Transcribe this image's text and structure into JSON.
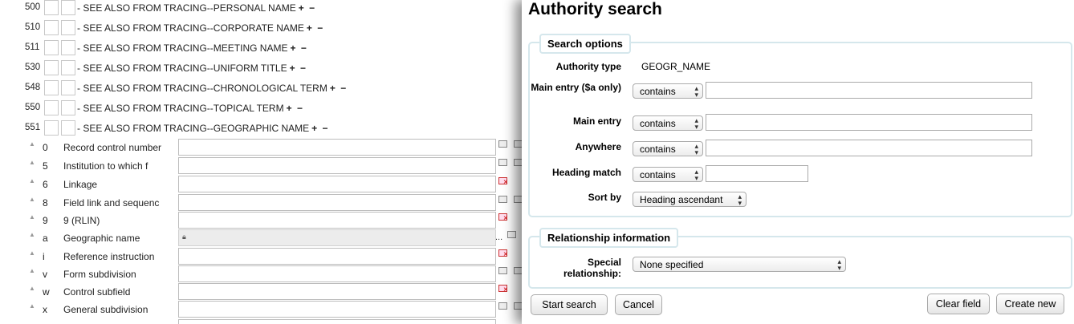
{
  "editor": {
    "tags": [
      {
        "tag": "500",
        "desc": "- SEE ALSO FROM TRACING--PERSONAL NAME",
        "plus": "+",
        "minus": "−"
      },
      {
        "tag": "510",
        "desc": "- SEE ALSO FROM TRACING--CORPORATE NAME",
        "plus": "+",
        "minus": "−"
      },
      {
        "tag": "511",
        "desc": "- SEE ALSO FROM TRACING--MEETING NAME",
        "plus": "+",
        "minus": "−"
      },
      {
        "tag": "530",
        "desc": "- SEE ALSO FROM TRACING--UNIFORM TITLE",
        "plus": "+",
        "minus": "−"
      },
      {
        "tag": "548",
        "desc": "- SEE ALSO FROM TRACING--CHRONOLOGICAL TERM",
        "plus": "+",
        "minus": "−"
      },
      {
        "tag": "550",
        "desc": "- SEE ALSO FROM TRACING--TOPICAL TERM",
        "plus": "+",
        "minus": "−"
      },
      {
        "tag": "551",
        "desc": "- SEE ALSO FROM TRACING--GEOGRAPHIC NAME",
        "plus": "+",
        "minus": "−"
      }
    ],
    "subfields": [
      {
        "code": "0",
        "label": "Record control number",
        "icons": "clone"
      },
      {
        "code": "5",
        "label": "Institution to which f",
        "icons": "clone"
      },
      {
        "code": "6",
        "label": "Linkage",
        "icons": "delete"
      },
      {
        "code": "8",
        "label": "Field link and sequenc",
        "icons": "clone"
      },
      {
        "code": "9",
        "label": "9 (RLIN)",
        "icons": "delete"
      },
      {
        "code": "a",
        "label": "Geographic name",
        "icons": "locked",
        "ellipsis": "..."
      },
      {
        "code": "i",
        "label": "Reference instruction",
        "icons": "delete"
      },
      {
        "code": "v",
        "label": "Form subdivision",
        "icons": "clone"
      },
      {
        "code": "w",
        "label": "Control subfield",
        "icons": "delete"
      },
      {
        "code": "x",
        "label": "General subdivision",
        "icons": "clone"
      }
    ]
  },
  "popup": {
    "title": "Authority search",
    "search_options": {
      "legend": "Search options",
      "authority_type_label": "Authority type",
      "authority_type_value": "GEOGR_NAME",
      "main_entry_a_label": "Main entry ($a only)",
      "main_entry_a_op": "contains",
      "main_entry_a_value": "",
      "main_entry_label": "Main entry",
      "main_entry_op": "contains",
      "main_entry_value": "",
      "anywhere_label": "Anywhere",
      "anywhere_op": "contains",
      "anywhere_value": "",
      "heading_match_label": "Heading match",
      "heading_match_op": "contains",
      "heading_match_value": "",
      "sort_by_label": "Sort by",
      "sort_by_value": "Heading ascendant"
    },
    "relationship": {
      "legend": "Relationship information",
      "special_label": "Special relationship:",
      "special_value": "None specified"
    },
    "buttons": {
      "start_search": "Start search",
      "cancel": "Cancel",
      "clear_field": "Clear field",
      "create_new": "Create new"
    }
  }
}
